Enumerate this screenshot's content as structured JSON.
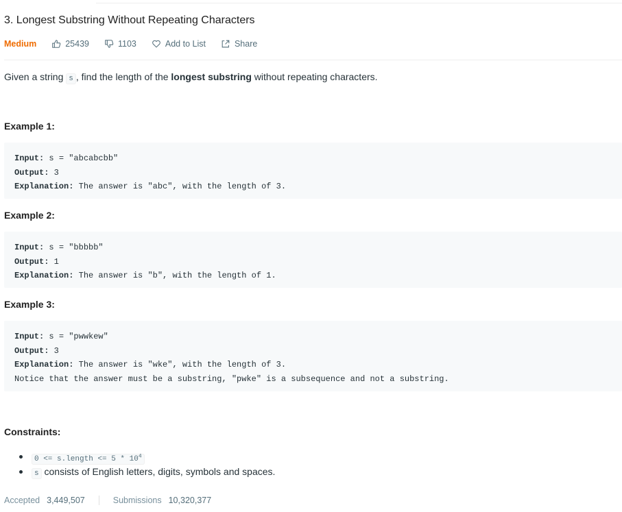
{
  "problem": {
    "title": "3. Longest Substring Without Repeating Characters",
    "difficulty": "Medium",
    "likes": "25439",
    "dislikes": "1103",
    "add_to_list": "Add to List",
    "share": "Share"
  },
  "description": {
    "before": "Given a string ",
    "var": "s",
    "middle": ", find the length of the ",
    "bold": "longest substring",
    "after": " without repeating characters."
  },
  "examples": [
    {
      "title": "Example 1:",
      "input_label": "Input:",
      "input": " s = \"abcabcbb\"",
      "output_label": "Output:",
      "output": " 3",
      "explanation_label": "Explanation:",
      "explanation": " The answer is \"abc\", with the length of 3."
    },
    {
      "title": "Example 2:",
      "input_label": "Input:",
      "input": " s = \"bbbbb\"",
      "output_label": "Output:",
      "output": " 1",
      "explanation_label": "Explanation:",
      "explanation": " The answer is \"b\", with the length of 1."
    },
    {
      "title": "Example 3:",
      "input_label": "Input:",
      "input": " s = \"pwwkew\"",
      "output_label": "Output:",
      "output": " 3",
      "explanation_label": "Explanation:",
      "explanation": " The answer is \"wke\", with the length of 3.",
      "note": "Notice that the answer must be a substring, \"pwke\" is a subsequence and not a substring."
    }
  ],
  "constraints": {
    "title": "Constraints:",
    "item1_code": "0 <= s.length <= 5 * 10",
    "item1_sup": "4",
    "item2_code": "s",
    "item2_text": " consists of English letters, digits, symbols and spaces."
  },
  "stats": {
    "accepted_label": "Accepted",
    "accepted": "3,449,507",
    "submissions_label": "Submissions",
    "submissions": "10,320,377"
  },
  "colors": {
    "medium": "#ef6c00",
    "code_bg": "#f7f9fa",
    "muted": "#78909c"
  },
  "icons": [
    "thumbs-up-icon",
    "thumbs-down-icon",
    "heart-icon",
    "share-icon"
  ]
}
